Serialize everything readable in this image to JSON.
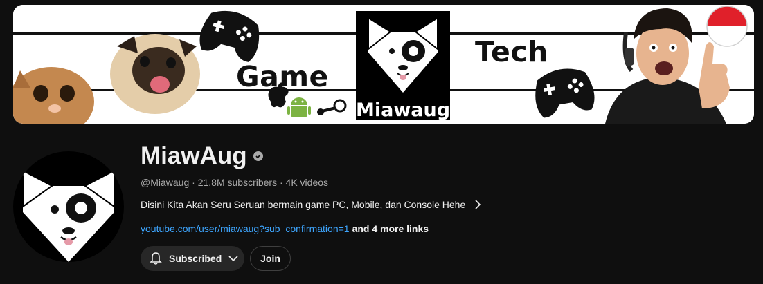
{
  "banner": {
    "word_game": "Game",
    "word_tech": "Tech",
    "logo_text": "Miawaug",
    "icons": [
      "apple-icon",
      "android-icon",
      "steam-icon",
      "gamepad-icon",
      "flag-indonesia-icon"
    ],
    "flag_colors": {
      "top": "#e0202a",
      "bottom": "#ffffff"
    }
  },
  "channel": {
    "name": "MiawAug",
    "verified_icon": "verified-check-icon",
    "handle": "@Miawaug",
    "subscribers": "21.8M subscribers",
    "videos": "4K videos",
    "separator": " · ",
    "description": "Disini Kita Akan Seru Seruan bermain game PC, Mobile, dan Console Hehe",
    "link": "youtube.com/user/miawaug?sub_confirmation=1",
    "more_links": "and 4 more links"
  },
  "buttons": {
    "subscribed": "Subscribed",
    "join": "Join"
  },
  "colors": {
    "background": "#0f0f0f",
    "link": "#3ea6ff",
    "button_bg": "#272727",
    "muted_text": "#aaaaaa"
  }
}
